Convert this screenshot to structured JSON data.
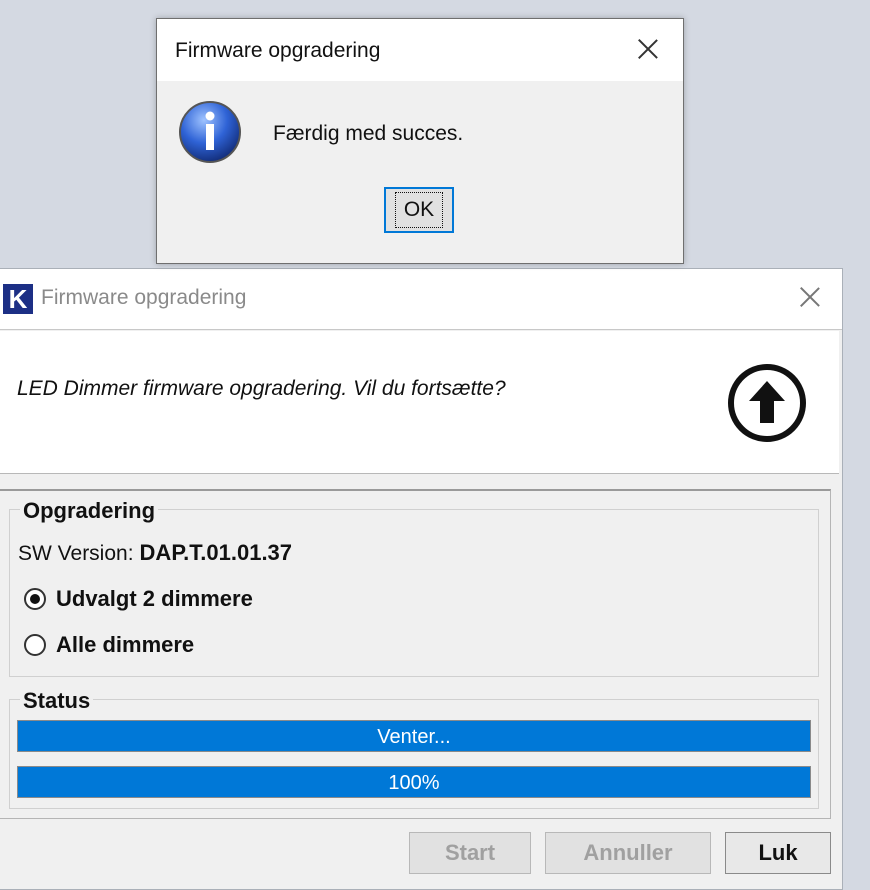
{
  "message_box": {
    "title": "Firmware opgradering",
    "icon": "info-icon",
    "message": "Færdig med succes.",
    "ok_label": "OK"
  },
  "main_window": {
    "logo_letter": "K",
    "title": "Firmware opgradering",
    "header_text": "LED Dimmer firmware opgradering. Vil du fortsætte?",
    "header_icon": "upload-arrow-icon",
    "upgrade_group": {
      "label": "Opgradering",
      "sw_version_label": "SW Version:",
      "sw_version_value": "DAP.T.01.01.37",
      "options": [
        {
          "label": "Udvalgt 2 dimmere",
          "selected": true
        },
        {
          "label": "Alle dimmere",
          "selected": false
        }
      ]
    },
    "status_group": {
      "label": "Status",
      "status_bar_text": "Venter...",
      "status_bar_fraction": 1.0,
      "progress_bar_text": "100%",
      "progress_bar_fraction": 1.0
    },
    "buttons": {
      "start": "Start",
      "cancel": "Annuller",
      "close": "Luk"
    }
  },
  "colors": {
    "accent": "#0078d7",
    "logo_bg": "#1c2f85",
    "desktop_bg": "#d4d9e2"
  }
}
